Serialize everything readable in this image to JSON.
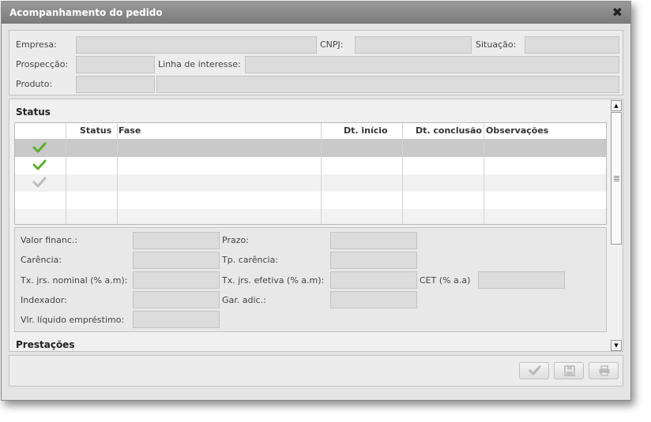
{
  "window": {
    "title": "Acompanhamento do pedido",
    "close_glyph": "✖"
  },
  "header": {
    "empresa_label": "Empresa:",
    "cnpj_label": "CNPJ:",
    "situacao_label": "Situação:",
    "prospeccao_label": "Prospecção:",
    "linha_label": "Linha de interesse:",
    "produto_label": "Produto:"
  },
  "status": {
    "title": "Status",
    "columns": [
      "",
      "Status",
      "Fase",
      "Dt. início",
      "Dt. conclusão",
      "Observações"
    ],
    "rows": [
      {
        "icon": "check-green-icon",
        "selected": true
      },
      {
        "icon": "check-green-icon",
        "selected": false
      },
      {
        "icon": "check-gray-icon",
        "selected": false
      },
      {
        "icon": "",
        "selected": false
      },
      {
        "icon": "",
        "selected": false
      }
    ]
  },
  "details": {
    "valor_label": "Valor financ.:",
    "prazo_label": "Prazo:",
    "carencia_label": "Carência:",
    "tp_carencia_label": "Tp. carência:",
    "tx_nominal_label": "Tx. jrs. nominal (% a.m):",
    "tx_efetiva_label": "Tx. jrs. efetiva (% a.m):",
    "cet_label": "CET (% a.a)",
    "indexador_label": "Indexador:",
    "gar_label": "Gar. adic.:",
    "vlr_liquido_label": "Vlr. líquido empréstimo:"
  },
  "prestacoes": {
    "title": "Prestações"
  },
  "colors": {
    "check_green": "#5fae2e",
    "check_gray": "#bdbdbd",
    "selected_row": "#c9c9c9"
  }
}
